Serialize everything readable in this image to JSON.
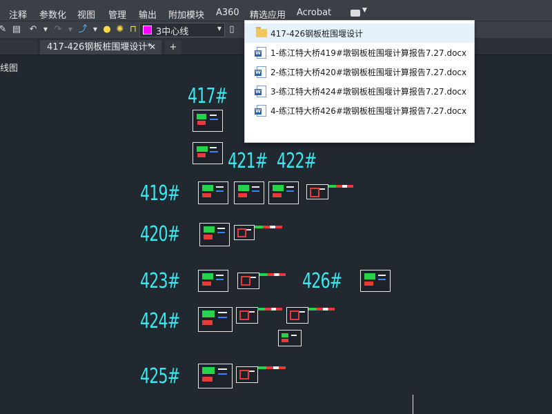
{
  "menubar": {
    "items": [
      "注释",
      "参数化",
      "视图",
      "管理",
      "输出",
      "附加模块",
      "A360",
      "精选应用",
      "Acrobat"
    ]
  },
  "toolbar": {
    "layer_name": "3中心线",
    "layer_color": "#ff00ff"
  },
  "tabs": {
    "active_tab": "417-426钢板桩围堰设计*",
    "new_tab": "+"
  },
  "viewport": {
    "label": "线图"
  },
  "piers": {
    "p417": "417#",
    "p421": "421#",
    "p422": "422#",
    "p419": "419#",
    "p420": "420#",
    "p423": "423#",
    "p426": "426#",
    "p424": "424#",
    "p425": "425#"
  },
  "popup": {
    "items": [
      "417-426钢板桩围堰设计",
      "1-练江特大桥419#墩钢板桩围堰计算报告7.27.docx",
      "2-练江特大桥420#墩钢板桩围堰计算报告7.27.docx",
      "3-练江特大桥424#墩钢板桩围堰计算报告7.27.docx",
      "4-练江特大桥426#墩钢板桩围堰计算报告7.27.docx"
    ]
  },
  "colors": {
    "canvas_bg": "#212830",
    "pier_label": "#38e8ee",
    "ui_bar": "#3b3f46"
  }
}
